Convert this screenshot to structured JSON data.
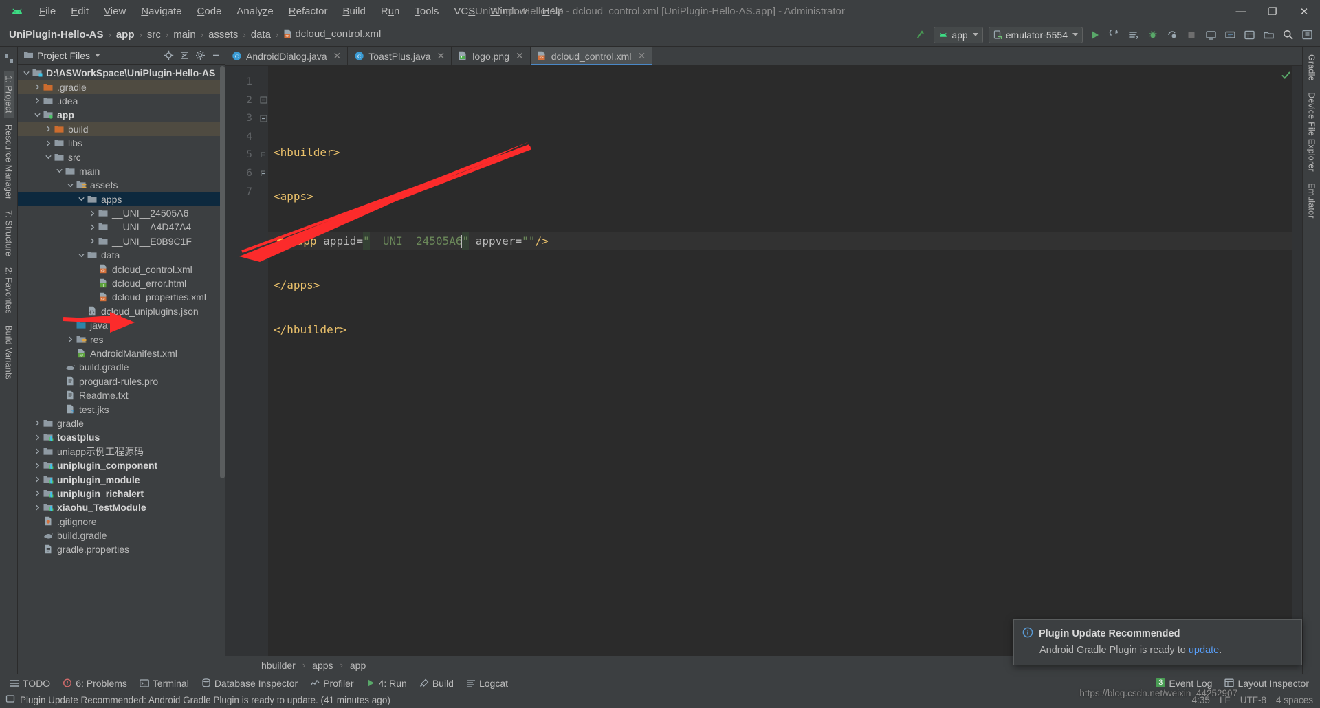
{
  "window": {
    "title": "UniPlugin-Hello-AS - dcloud_control.xml [UniPlugin-Hello-AS.app] - Administrator",
    "minimize": "—",
    "maximize": "❐",
    "close": "✕"
  },
  "menu": [
    {
      "label": "File",
      "mnemonic": "F"
    },
    {
      "label": "Edit",
      "mnemonic": "E"
    },
    {
      "label": "View",
      "mnemonic": "V"
    },
    {
      "label": "Navigate",
      "mnemonic": "N"
    },
    {
      "label": "Code",
      "mnemonic": "C"
    },
    {
      "label": "Analyze",
      "mnemonic": "z"
    },
    {
      "label": "Refactor",
      "mnemonic": "R"
    },
    {
      "label": "Build",
      "mnemonic": "B"
    },
    {
      "label": "Run",
      "mnemonic": "u"
    },
    {
      "label": "Tools",
      "mnemonic": "T"
    },
    {
      "label": "VCS",
      "mnemonic": "S"
    },
    {
      "label": "Window",
      "mnemonic": "W"
    },
    {
      "label": "Help",
      "mnemonic": "H"
    }
  ],
  "breadcrumbs": [
    {
      "label": "UniPlugin-Hello-AS",
      "bold": true
    },
    {
      "label": "app",
      "bold": true
    },
    {
      "label": "src",
      "bold": false
    },
    {
      "label": "main",
      "bold": false
    },
    {
      "label": "assets",
      "bold": false
    },
    {
      "label": "data",
      "bold": false
    },
    {
      "label": "dcloud_control.xml",
      "bold": false,
      "icon": "xml-file-icon"
    }
  ],
  "toolbar": {
    "run_config": "app",
    "device": "emulator-5554",
    "icons": [
      "run-icon",
      "rerun-icon",
      "apply-changes-icon",
      "debug-icon",
      "profile-icon",
      "attach-debugger-icon",
      "stop-icon",
      "avd-manager-icon",
      "sdk-manager-icon",
      "layout-inspector-icon",
      "device-explorer-icon",
      "search-icon",
      "settings-icon"
    ]
  },
  "left_rail": [
    {
      "label": "1: Project",
      "active": true
    },
    {
      "label": "Resource Manager",
      "active": false
    },
    {
      "label": "7: Structure",
      "active": false
    },
    {
      "label": "2: Favorites",
      "active": false
    },
    {
      "label": "Build Variants",
      "active": false
    }
  ],
  "right_rail": [
    {
      "label": "Gradle"
    },
    {
      "label": "Device File Explorer"
    },
    {
      "label": "Emulator"
    }
  ],
  "project_panel": {
    "title": "Project Files",
    "icons": [
      "locate-icon",
      "collapse-all-icon",
      "settings-icon",
      "hide-icon"
    ],
    "tree": [
      {
        "depth": 0,
        "label": "D:\\ASWorkSpace\\UniPlugin-Hello-AS",
        "arrow": "down",
        "icon": "module-folder-icon",
        "bold": true,
        "state": "normal"
      },
      {
        "depth": 1,
        "label": ".gradle",
        "arrow": "right",
        "icon": "excluded-folder-icon",
        "bold": false,
        "state": "modified"
      },
      {
        "depth": 1,
        "label": ".idea",
        "arrow": "right",
        "icon": "folder-icon",
        "bold": false,
        "state": "normal"
      },
      {
        "depth": 1,
        "label": "app",
        "arrow": "down",
        "icon": "source-folder-icon",
        "bold": true,
        "state": "normal"
      },
      {
        "depth": 2,
        "label": "build",
        "arrow": "right",
        "icon": "excluded-folder-icon",
        "bold": false,
        "state": "modified"
      },
      {
        "depth": 2,
        "label": "libs",
        "arrow": "right",
        "icon": "folder-icon",
        "bold": false,
        "state": "normal"
      },
      {
        "depth": 2,
        "label": "src",
        "arrow": "down",
        "icon": "folder-icon",
        "bold": false,
        "state": "normal"
      },
      {
        "depth": 3,
        "label": "main",
        "arrow": "down",
        "icon": "folder-icon",
        "bold": false,
        "state": "normal"
      },
      {
        "depth": 4,
        "label": "assets",
        "arrow": "down",
        "icon": "assets-folder-icon",
        "bold": false,
        "state": "normal"
      },
      {
        "depth": 5,
        "label": "apps",
        "arrow": "down",
        "icon": "folder-icon",
        "bold": false,
        "state": "selected"
      },
      {
        "depth": 6,
        "label": "__UNI__24505A6",
        "arrow": "right",
        "icon": "folder-icon",
        "bold": false,
        "state": "normal"
      },
      {
        "depth": 6,
        "label": "__UNI__A4D47A4",
        "arrow": "right",
        "icon": "folder-icon",
        "bold": false,
        "state": "normal"
      },
      {
        "depth": 6,
        "label": "__UNI__E0B9C1F",
        "arrow": "right",
        "icon": "folder-icon",
        "bold": false,
        "state": "normal"
      },
      {
        "depth": 5,
        "label": "data",
        "arrow": "down",
        "icon": "folder-icon",
        "bold": false,
        "state": "normal"
      },
      {
        "depth": 6,
        "label": "dcloud_control.xml",
        "arrow": "none",
        "icon": "xml-file-icon",
        "bold": false,
        "state": "normal"
      },
      {
        "depth": 6,
        "label": "dcloud_error.html",
        "arrow": "none",
        "icon": "html-file-icon",
        "bold": false,
        "state": "normal"
      },
      {
        "depth": 6,
        "label": "dcloud_properties.xml",
        "arrow": "none",
        "icon": "xml-file-icon",
        "bold": false,
        "state": "normal"
      },
      {
        "depth": 5,
        "label": "dcloud_uniplugins.json",
        "arrow": "none",
        "icon": "json-file-icon",
        "bold": false,
        "state": "normal"
      },
      {
        "depth": 4,
        "label": "java",
        "arrow": "none",
        "icon": "java-source-folder-icon",
        "bold": false,
        "state": "normal"
      },
      {
        "depth": 4,
        "label": "res",
        "arrow": "right",
        "icon": "res-folder-icon",
        "bold": false,
        "state": "normal"
      },
      {
        "depth": 4,
        "label": "AndroidManifest.xml",
        "arrow": "none",
        "icon": "manifest-file-icon",
        "bold": false,
        "state": "normal"
      },
      {
        "depth": 3,
        "label": "build.gradle",
        "arrow": "none",
        "icon": "gradle-file-icon",
        "bold": false,
        "state": "normal"
      },
      {
        "depth": 3,
        "label": "proguard-rules.pro",
        "arrow": "none",
        "icon": "text-file-icon",
        "bold": false,
        "state": "normal"
      },
      {
        "depth": 3,
        "label": "Readme.txt",
        "arrow": "none",
        "icon": "text-file-icon",
        "bold": false,
        "state": "normal"
      },
      {
        "depth": 3,
        "label": "test.jks",
        "arrow": "none",
        "icon": "unknown-file-icon",
        "bold": false,
        "state": "normal"
      },
      {
        "depth": 1,
        "label": "gradle",
        "arrow": "right",
        "icon": "folder-icon",
        "bold": false,
        "state": "normal"
      },
      {
        "depth": 1,
        "label": "toastplus",
        "arrow": "right",
        "icon": "library-module-icon",
        "bold": true,
        "state": "normal"
      },
      {
        "depth": 1,
        "label": "uniapp示例工程源码",
        "arrow": "right",
        "icon": "folder-icon",
        "bold": false,
        "state": "normal"
      },
      {
        "depth": 1,
        "label": "uniplugin_component",
        "arrow": "right",
        "icon": "library-module-icon",
        "bold": true,
        "state": "normal"
      },
      {
        "depth": 1,
        "label": "uniplugin_module",
        "arrow": "right",
        "icon": "library-module-icon",
        "bold": true,
        "state": "normal"
      },
      {
        "depth": 1,
        "label": "uniplugin_richalert",
        "arrow": "right",
        "icon": "library-module-icon",
        "bold": true,
        "state": "normal"
      },
      {
        "depth": 1,
        "label": "xiaohu_TestModule",
        "arrow": "right",
        "icon": "library-module-icon",
        "bold": true,
        "state": "normal"
      },
      {
        "depth": 1,
        "label": ".gitignore",
        "arrow": "none",
        "icon": "gitignore-file-icon",
        "bold": false,
        "state": "normal"
      },
      {
        "depth": 1,
        "label": "build.gradle",
        "arrow": "none",
        "icon": "gradle-file-icon",
        "bold": false,
        "state": "normal"
      },
      {
        "depth": 1,
        "label": "gradle.properties",
        "arrow": "none",
        "icon": "properties-file-icon",
        "bold": false,
        "state": "normal"
      }
    ]
  },
  "editor_tabs": [
    {
      "label": "AndroidDialog.java",
      "icon": "java-class-icon",
      "active": false
    },
    {
      "label": "ToastPlus.java",
      "icon": "java-class-icon",
      "active": false
    },
    {
      "label": "logo.png",
      "icon": "image-file-icon",
      "active": false
    },
    {
      "label": "dcloud_control.xml",
      "icon": "xml-file-icon",
      "active": true
    }
  ],
  "code": {
    "line_numbers": [
      "1",
      "2",
      "3",
      "4",
      "5",
      "6",
      "7"
    ],
    "lines": [
      {
        "n": 1,
        "text": "",
        "fold": "none",
        "bulb": false,
        "current": false
      },
      {
        "n": 2,
        "text": "<hbuilder>",
        "fold": "open",
        "bulb": false,
        "current": false
      },
      {
        "n": 3,
        "text": "<apps>",
        "fold": "open",
        "bulb": false,
        "current": false
      },
      {
        "n": 4,
        "text": "<app appid=\"__UNI__24505A6\" appver=\"\"/>",
        "fold": "none",
        "bulb": true,
        "current": true
      },
      {
        "n": 5,
        "text": "</apps>",
        "fold": "close",
        "bulb": false,
        "current": false
      },
      {
        "n": 6,
        "text": "</hbuilder>",
        "fold": "close",
        "bulb": false,
        "current": false
      },
      {
        "n": 7,
        "text": "",
        "fold": "none",
        "bulb": false,
        "current": false
      }
    ],
    "line4_parts": {
      "tag_open": "<app ",
      "attr1": "appid=",
      "quote1": "\"",
      "value1": "__UNI__24505A6",
      "quote2": "\"",
      "attr2": " appver=",
      "quote3": "\"\"",
      "tag_close": "/>"
    },
    "inspection_status": "ok-check-icon"
  },
  "editor_breadcrumbs": [
    "hbuilder",
    "apps",
    "app"
  ],
  "notification": {
    "icon": "info-icon",
    "title": "Plugin Update Recommended",
    "body_before": "Android Gradle Plugin is ready to ",
    "link": "update",
    "body_after": "."
  },
  "bottom_tools": [
    {
      "label": "TODO",
      "icon": "todo-icon"
    },
    {
      "label": "6: Problems",
      "icon": "problems-icon"
    },
    {
      "label": "Terminal",
      "icon": "terminal-icon"
    },
    {
      "label": "Database Inspector",
      "icon": "database-icon"
    },
    {
      "label": "Profiler",
      "icon": "profiler-icon"
    },
    {
      "label": "4: Run",
      "icon": "run-icon"
    },
    {
      "label": "Build",
      "icon": "build-icon"
    },
    {
      "label": "Logcat",
      "icon": "logcat-icon"
    }
  ],
  "bottom_tools_right": [
    {
      "label": "Event Log",
      "icon": "event-log-icon",
      "badge": "3"
    },
    {
      "label": "Layout Inspector",
      "icon": "layout-inspector-icon",
      "badge": ""
    }
  ],
  "status_bar": {
    "message": "Plugin Update Recommended: Android Gradle Plugin is ready to update. (41 minutes ago)",
    "position": "4:35",
    "line_sep": "LF",
    "encoding": "UTF-8",
    "indent": "4 spaces"
  },
  "watermark": "https://blog.csdn.net/weixin_44252907",
  "colors": {
    "accent_blue": "#4a88c7",
    "selection": "#0d293e",
    "modified": "#4f4b41",
    "string_green": "#6a8759",
    "tag_yellow": "#e8bf6a",
    "arrow_red": "#fc2b2b",
    "link_blue": "#589df6",
    "android_green": "#3ddc84"
  }
}
